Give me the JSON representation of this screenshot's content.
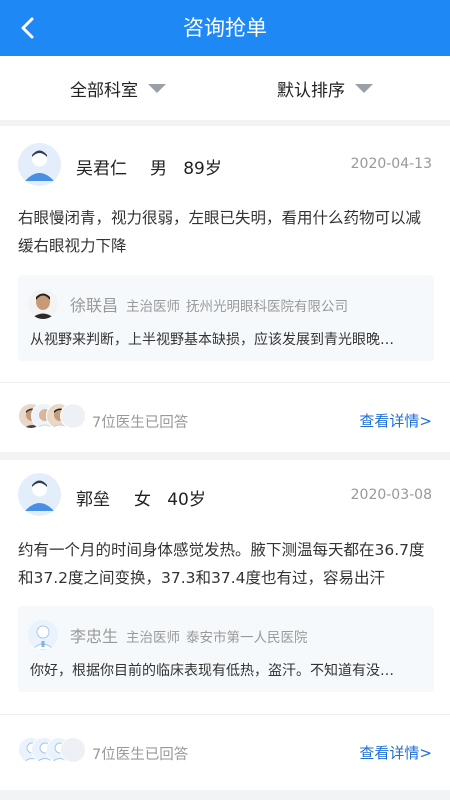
{
  "header": {
    "title": "咨询抢单"
  },
  "filters": {
    "department": "全部科室",
    "sort": "默认排序"
  },
  "cards": [
    {
      "patient": {
        "name": "吴君仁",
        "gender": "男",
        "age": "89岁"
      },
      "date": "2020-04-13",
      "question": "右眼慢闭青，视力很弱，左眼已失明，看用什么药物可以减缓右眼视力下降",
      "answer": {
        "doctor_name": "徐联昌",
        "doctor_title": "主治医师",
        "hospital": "抚州光明眼科医院有限公司",
        "text": "从视野来判断，上半视野基本缺损，应该发展到青光眼晚…"
      },
      "answered_count": "7位医生已回答",
      "detail_label": "查看详情>"
    },
    {
      "patient": {
        "name": "郭垒",
        "gender": "女",
        "age": "40岁"
      },
      "date": "2020-03-08",
      "question": "约有一个月的时间身体感觉发热。腋下测温每天都在36.7度和37.2度之间变换，37.3和37.4度也有过，容易出汗",
      "answer": {
        "doctor_name": "李忠生",
        "doctor_title": "主治医师",
        "hospital": "泰安市第一人民医院",
        "text": "你好，根据你目前的临床表现有低热，盗汗。不知道有没…"
      },
      "answered_count": "7位医生已回答",
      "detail_label": "查看详情>"
    }
  ],
  "colors": {
    "brand": "#1e88f5",
    "link": "#1e6fd6"
  }
}
